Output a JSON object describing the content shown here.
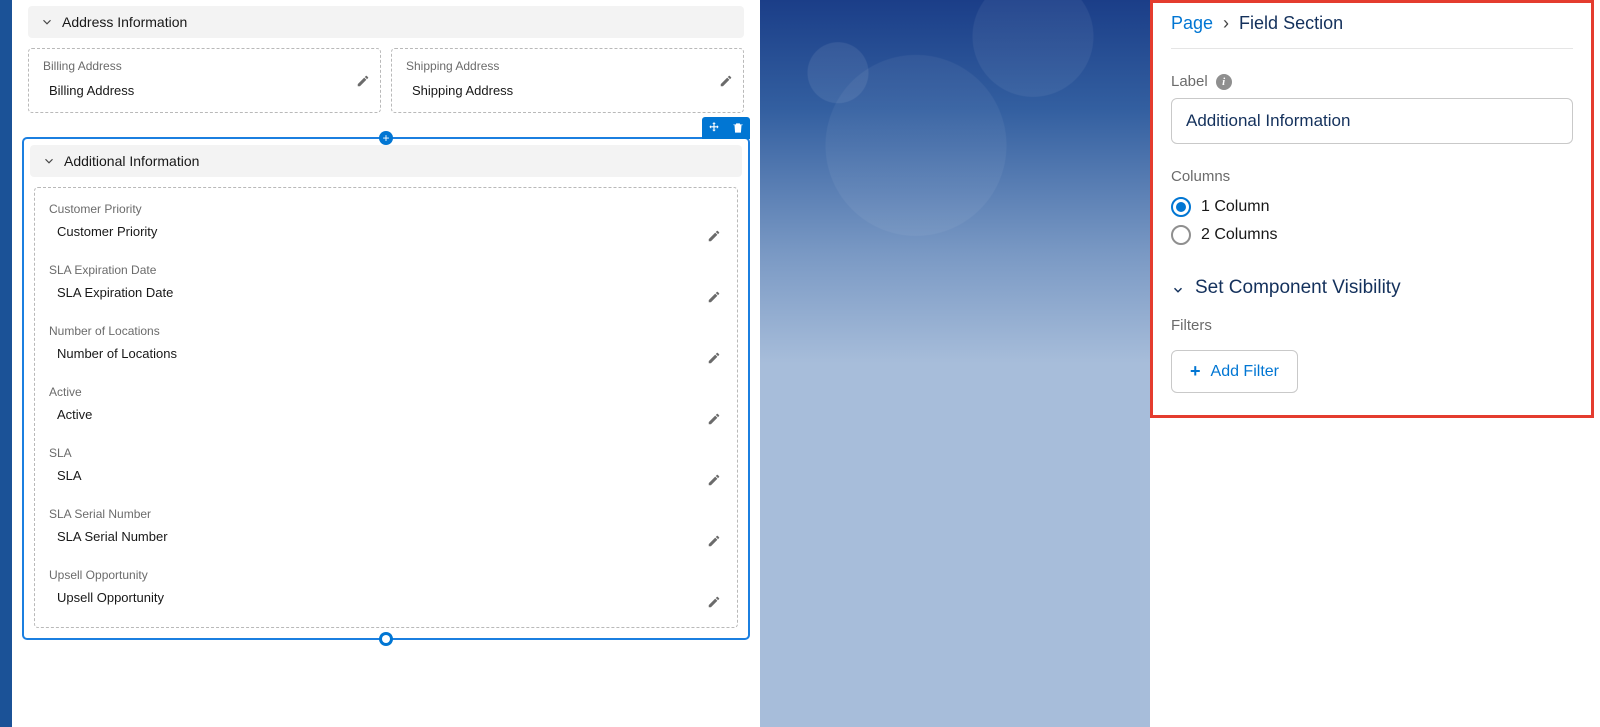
{
  "sections": {
    "address": {
      "title": "Address Information",
      "billing": {
        "label": "Billing Address",
        "value": "Billing Address"
      },
      "shipping": {
        "label": "Shipping Address",
        "value": "Shipping Address"
      }
    },
    "additional": {
      "title": "Additional Information",
      "fields": [
        {
          "label": "Customer Priority",
          "value": "Customer Priority"
        },
        {
          "label": "SLA Expiration Date",
          "value": "SLA Expiration Date"
        },
        {
          "label": "Number of Locations",
          "value": "Number of Locations"
        },
        {
          "label": "Active",
          "value": "Active"
        },
        {
          "label": "SLA",
          "value": "SLA"
        },
        {
          "label": "SLA Serial Number",
          "value": "SLA Serial Number"
        },
        {
          "label": "Upsell Opportunity",
          "value": "Upsell Opportunity"
        }
      ]
    }
  },
  "panel": {
    "breadcrumb": {
      "page": "Page",
      "current": "Field Section"
    },
    "label_field": {
      "label": "Label",
      "value": "Additional Information"
    },
    "columns": {
      "label": "Columns",
      "opt1": "1 Column",
      "opt2": "2 Columns",
      "selected": "1"
    },
    "visibility": {
      "title": "Set Component Visibility"
    },
    "filters": {
      "label": "Filters",
      "add": "Add Filter"
    }
  },
  "icons": {
    "insert_plus": "+"
  }
}
